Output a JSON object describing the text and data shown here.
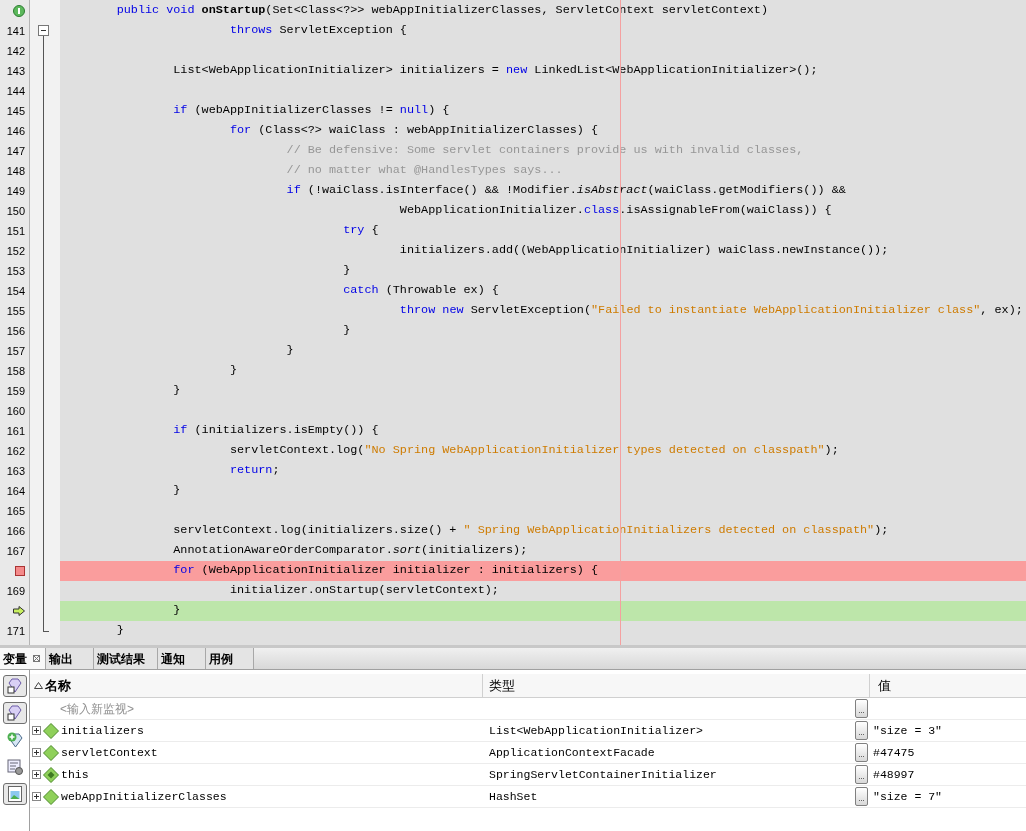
{
  "editor": {
    "lines": [
      {
        "kind": "override",
        "tokens": [
          {
            "kind": "kw",
            "text": "        public "
          },
          {
            "kind": "kw",
            "text": "void "
          },
          {
            "kind": "bold",
            "text": "onStartup"
          },
          {
            "kind": "plain",
            "text": "(Set<Class<?>> webAppInitializerClasses, ServletContext servletContext)"
          }
        ]
      },
      {
        "kind": "fold",
        "expanded": true,
        "number": "141",
        "tokens": [
          {
            "kind": "kw",
            "text": "                        throws"
          },
          {
            "kind": "plain",
            "text": " ServletException {"
          }
        ]
      },
      {
        "kind": "plain",
        "number": "142"
      },
      {
        "kind": "plain",
        "number": "143",
        "tokens": [
          {
            "kind": "plain",
            "text": "                List<WebApplicationInitializer> initializers = "
          },
          {
            "kind": "kw",
            "text": "new"
          },
          {
            "kind": "plain",
            "text": " LinkedList<WebApplicationInitializer>();"
          }
        ]
      },
      {
        "kind": "plain",
        "number": "144"
      },
      {
        "kind": "plain",
        "number": "145",
        "tokens": [
          {
            "kind": "kw",
            "text": "                if"
          },
          {
            "kind": "plain",
            "text": " (webAppInitializerClasses != "
          },
          {
            "kind": "kw",
            "text": "null"
          },
          {
            "kind": "plain",
            "text": ") {"
          }
        ]
      },
      {
        "kind": "plain",
        "number": "146",
        "tokens": [
          {
            "kind": "kw",
            "text": "                        for"
          },
          {
            "kind": "plain",
            "text": " (Class<?> waiClass : webAppInitializerClasses) {"
          }
        ]
      },
      {
        "kind": "plain",
        "number": "147",
        "tokens": [
          {
            "kind": "comment",
            "text": "                                // Be defensive: Some servlet containers provide us with invalid classes,"
          }
        ]
      },
      {
        "kind": "plain",
        "number": "148",
        "tokens": [
          {
            "kind": "comment",
            "text": "                                // no matter what @HandlesTypes says..."
          }
        ]
      },
      {
        "kind": "plain",
        "number": "149",
        "tokens": [
          {
            "kind": "kw",
            "text": "                                if"
          },
          {
            "kind": "plain",
            "text": " (!waiClass.isInterface() && !Modifier."
          },
          {
            "kind": "it",
            "text": "isAbstract"
          },
          {
            "kind": "plain",
            "text": "(waiClass.getModifiers()) &&"
          }
        ]
      },
      {
        "kind": "plain",
        "number": "150",
        "tokens": [
          {
            "kind": "plain",
            "text": "                                                WebApplicationInitializer."
          },
          {
            "kind": "kw",
            "text": "class"
          },
          {
            "kind": "plain",
            "text": ".isAssignableFrom(waiClass)) {"
          }
        ]
      },
      {
        "kind": "plain",
        "number": "151",
        "tokens": [
          {
            "kind": "kw",
            "text": "                                        try"
          },
          {
            "kind": "plain",
            "text": " {"
          }
        ]
      },
      {
        "kind": "plain",
        "number": "152",
        "tokens": [
          {
            "kind": "plain",
            "text": "                                                initializers.add((WebApplicationInitializer) waiClass.newInstance());"
          }
        ]
      },
      {
        "kind": "plain",
        "number": "153",
        "tokens": [
          {
            "kind": "plain",
            "text": "                                        }"
          }
        ]
      },
      {
        "kind": "plain",
        "number": "154",
        "tokens": [
          {
            "kind": "kw",
            "text": "                                        catch"
          },
          {
            "kind": "plain",
            "text": " (Throwable ex) {"
          }
        ]
      },
      {
        "kind": "plain",
        "number": "155",
        "tokens": [
          {
            "kind": "kw",
            "text": "                                                throw "
          },
          {
            "kind": "kw",
            "text": "new"
          },
          {
            "kind": "plain",
            "text": " ServletException("
          },
          {
            "kind": "str",
            "text": "\"Failed to instantiate WebApplicationInitializer class\""
          },
          {
            "kind": "plain",
            "text": ", ex);"
          }
        ]
      },
      {
        "kind": "plain",
        "number": "156",
        "tokens": [
          {
            "kind": "plain",
            "text": "                                        }"
          }
        ]
      },
      {
        "kind": "plain",
        "number": "157",
        "tokens": [
          {
            "kind": "plain",
            "text": "                                }"
          }
        ]
      },
      {
        "kind": "plain",
        "number": "158",
        "tokens": [
          {
            "kind": "plain",
            "text": "                        }"
          }
        ]
      },
      {
        "kind": "plain",
        "number": "159",
        "tokens": [
          {
            "kind": "plain",
            "text": "                }"
          }
        ]
      },
      {
        "kind": "plain",
        "number": "160"
      },
      {
        "kind": "plain",
        "number": "161",
        "tokens": [
          {
            "kind": "kw",
            "text": "                if"
          },
          {
            "kind": "plain",
            "text": " (initializers.isEmpty()) {"
          }
        ]
      },
      {
        "kind": "plain",
        "number": "162",
        "tokens": [
          {
            "kind": "plain",
            "text": "                        servletContext.log("
          },
          {
            "kind": "str",
            "text": "\"No Spring WebApplicationInitializer types detected on classpath\""
          },
          {
            "kind": "plain",
            "text": ");"
          }
        ]
      },
      {
        "kind": "plain",
        "number": "163",
        "tokens": [
          {
            "kind": "kw",
            "text": "                        return"
          },
          {
            "kind": "plain",
            "text": ";"
          }
        ]
      },
      {
        "kind": "plain",
        "number": "164",
        "tokens": [
          {
            "kind": "plain",
            "text": "                }"
          }
        ]
      },
      {
        "kind": "plain",
        "number": "165"
      },
      {
        "kind": "plain",
        "number": "166",
        "tokens": [
          {
            "kind": "plain",
            "text": "                servletContext.log(initializers.size() + "
          },
          {
            "kind": "str",
            "text": "\" Spring WebApplicationInitializers detected on classpath\""
          },
          {
            "kind": "plain",
            "text": ");"
          }
        ]
      },
      {
        "kind": "plain",
        "number": "167",
        "tokens": [
          {
            "kind": "plain",
            "text": "                AnnotationAwareOrderComparator."
          },
          {
            "kind": "it",
            "text": "sort"
          },
          {
            "kind": "plain",
            "text": "(initializers);"
          }
        ]
      },
      {
        "kind": "breakpoint",
        "tokens": [
          {
            "kind": "kw",
            "text": "                for"
          },
          {
            "kind": "plain",
            "text": " (WebApplicationInitializer initializer : initializers) {"
          }
        ]
      },
      {
        "kind": "plain",
        "number": "169",
        "tokens": [
          {
            "kind": "plain",
            "text": "                        initializer.onStartup(servletContext);"
          }
        ]
      },
      {
        "kind": "current",
        "tokens": [
          {
            "kind": "plain",
            "text": "                }"
          }
        ]
      },
      {
        "kind": "fold_end",
        "number": "171",
        "tokens": [
          {
            "kind": "plain",
            "text": "        }"
          }
        ]
      }
    ]
  },
  "panel": {
    "tabs": [
      {
        "label": "变量",
        "selected": true
      },
      {
        "label": "输出",
        "selected": false
      },
      {
        "label": "测试结果",
        "selected": false
      },
      {
        "label": "通知",
        "selected": false
      },
      {
        "label": "用例",
        "selected": false
      }
    ],
    "toolbar": [
      {
        "kind": "gem",
        "pressed": true
      },
      {
        "kind": "gem",
        "pressed": true
      },
      {
        "kind": "add",
        "pressed": false
      },
      {
        "kind": "tools",
        "pressed": false
      },
      {
        "kind": "picture",
        "pressed": true
      }
    ],
    "columns": [
      "名称",
      "类型",
      "值"
    ],
    "watch_placeholder": "<输入新监视>",
    "watch_button": "...",
    "variables": [
      {
        "kind": "local",
        "expanded": false,
        "name": "initializers",
        "type": "List<WebApplicationInitializer>",
        "button": "...",
        "value": "\"size = 3\""
      },
      {
        "kind": "local",
        "expanded": false,
        "name": "servletContext",
        "type": "ApplicationContextFacade",
        "button": "...",
        "value": "#47475"
      },
      {
        "kind": "this",
        "expanded": false,
        "name": "this",
        "type": "SpringServletContainerInitializer",
        "button": "...",
        "value": "#48997"
      },
      {
        "kind": "local",
        "expanded": false,
        "name": "webAppInitializerClasses",
        "type": "HashSet",
        "button": "...",
        "value": "\"size = 7\""
      }
    ]
  }
}
